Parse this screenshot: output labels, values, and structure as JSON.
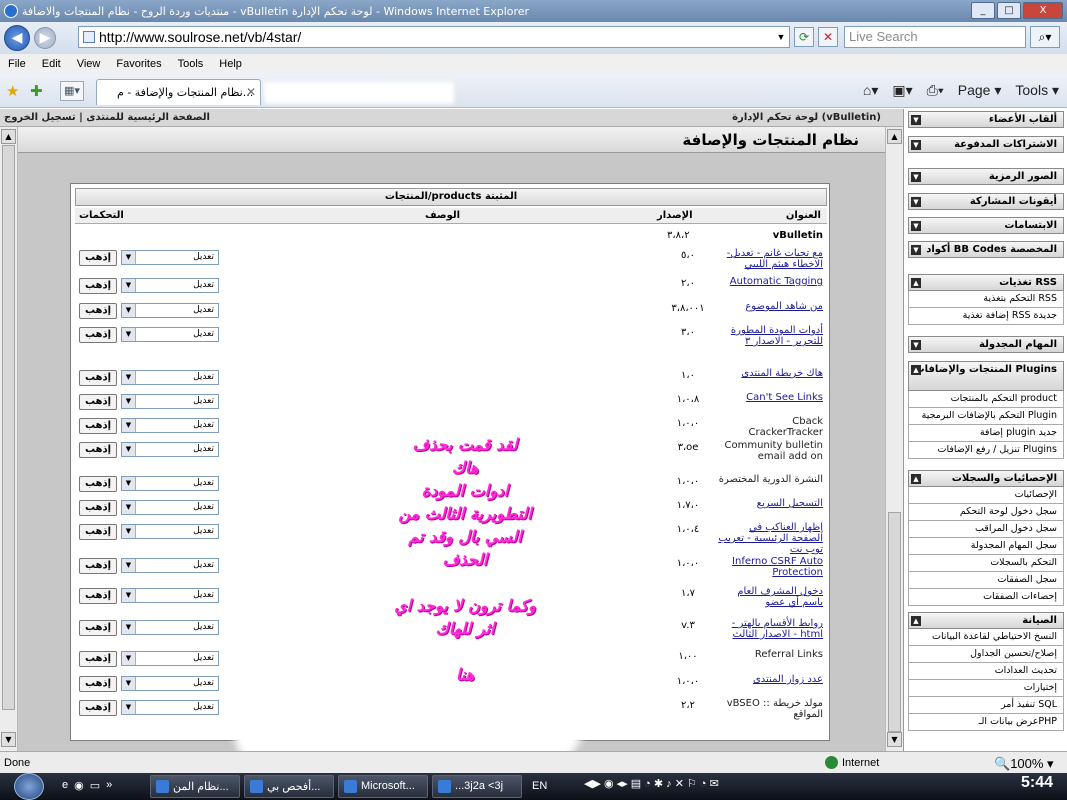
{
  "window": {
    "title": "منتديات وردة الروح - نظام المنتجات والاضافة - vBulletin لوحة تحكم الإدارة - Windows Internet Explorer",
    "controls": [
      "_",
      "□",
      "X"
    ]
  },
  "browser": {
    "url": "http://www.soulrose.net/vb/4star/",
    "search_placeholder": "Live Search",
    "menu": [
      "File",
      "Edit",
      "View",
      "Favorites",
      "Tools",
      "Help"
    ],
    "active_tab": "نظام المنتجات والإضافة - م...",
    "tools_page": "Page",
    "tools_tools": "Tools"
  },
  "cp": {
    "top_right": "لوحة تحكم الإدارة (vBulletin)",
    "top_left": "الصفحة الرئيسية للمنتدى | تسجيل الخروج",
    "page_title": "نظام المنتجات والإصافة",
    "table_caption": "المنتجات/products المثبتة",
    "col_title": "العنوان",
    "col_version": "الإصدار",
    "col_desc": "الوصف",
    "col_controls": "التحكمات",
    "vb_label": "vBulletin",
    "vb_version": "٣،٨،٢",
    "select_value": "تعديل",
    "go_label": "إذهب",
    "products": [
      {
        "title": "-مع تحيات غانم - تعديل الاخطاء هيثم الليبي",
        "version": "٥،٠",
        "link": true
      },
      {
        "title": "Automatic Tagging",
        "version": "٢،٠",
        "link": true
      },
      {
        "title": "من شاهد الموضوع",
        "version": "٣،٨،٠٠١",
        "link": true
      },
      {
        "title": "أدوات المودة المطورة للتحرير - الاصدار ٣",
        "version": "٣،٠",
        "link": true
      },
      {
        "title": "هاك خريطة المنتدى",
        "version": "١،٠",
        "link": true
      },
      {
        "title": "Can't See Links",
        "version": "١،٠،٨",
        "link": true
      },
      {
        "title": "Cback CrackerTracker",
        "version": "١،٠،٠",
        "link": false
      },
      {
        "title": "Community bulletin email add on",
        "version": "٣،oe",
        "link": false
      },
      {
        "title": "النشرة الدورية المختصرة",
        "version": "١،٠،٠",
        "link": false
      },
      {
        "title": "التسجيل السريع",
        "version": "١،٧،٠",
        "link": true
      },
      {
        "title": "إظهار العناكب في الصفحة الرئيسية - تعريب توب نت",
        "version": "١،٠،٤",
        "link": true
      },
      {
        "title": "Inferno CSRF Auto Protection",
        "version": "١،٠،٠",
        "link": true
      },
      {
        "title": "دخول المشرف العام باسم أي عضو",
        "version": "١،٧",
        "link": true
      },
      {
        "title": "روابط الأقسام بالهتر - الاصدار الثالث - html",
        "version": "v.٣",
        "link": true
      },
      {
        "title": "Referral Links",
        "version": "١،٠٠",
        "link": false
      },
      {
        "title": "عدد زوار المنتدى",
        "version": "١،٠،٠",
        "link": true
      },
      {
        "title": "vBSEO :: مولد خريطة المواقع",
        "version": "٢،٢",
        "link": false
      }
    ]
  },
  "overlay_text": [
    "لقد قمت بحذف",
    "هاك",
    "ادوات المودة",
    "التطويرية الثالث من",
    "السي بال وقد تم",
    "الحذف",
    "",
    "وكما ترون لا يوجد اي",
    "اثر للهاك",
    "",
    "هنا"
  ],
  "sidebar": {
    "groups": [
      {
        "head": "ألقاب الأعضاء",
        "items": []
      },
      {
        "head": "الاشتراكات المدفوعة",
        "items": []
      },
      {
        "head": "الصور الرمزية",
        "items": []
      },
      {
        "head": "أيقونات المشاركة",
        "items": []
      },
      {
        "head": "الابتسامات",
        "items": []
      },
      {
        "head": "أكواد BB Codes المخصصة",
        "items": []
      },
      {
        "head": "تغذيات RSS",
        "items": [
          "التحكم بتغذية RSS",
          "إضافة تغذية RSS جديدة"
        ]
      },
      {
        "head": "المهام المجدولة",
        "items": []
      },
      {
        "head": "المنتجات والإضافات Plugins",
        "items": [
          "التحكم بالمنتجات product",
          "التحكم بالإضافات البرمجية Plugin",
          "إضافة plugin جديد",
          "تنزيل / رفع الإضافات Plugins"
        ]
      },
      {
        "head": "الإحصائيات والسجلات",
        "items": [
          "الإحصائيات",
          "سجل دخول لوحة التحكم",
          "سجل دخول المراقب",
          "سجل المهام المجدولة",
          "التحكم بالسجلات",
          "سجل الصفقات",
          "إحصاءات الصفقات"
        ]
      },
      {
        "head": "الصيانة",
        "items": [
          "النسخ الاحتياطي لقاعدة البيانات",
          "إصلاح/تحسين الجداول",
          "تحديث العدادات",
          "إختيارات",
          "تنفيذ أمر SQL",
          "عرض بيانات الـPHP"
        ]
      }
    ]
  },
  "status": {
    "left": "Done",
    "zone": "Internet",
    "zoom": "100%"
  },
  "taskbar": {
    "buttons": [
      "نظام المن...",
      "أفحص بي...",
      "Microsoft...",
      "...3j2a <3j"
    ],
    "lang": "EN",
    "clock": "5:44"
  }
}
